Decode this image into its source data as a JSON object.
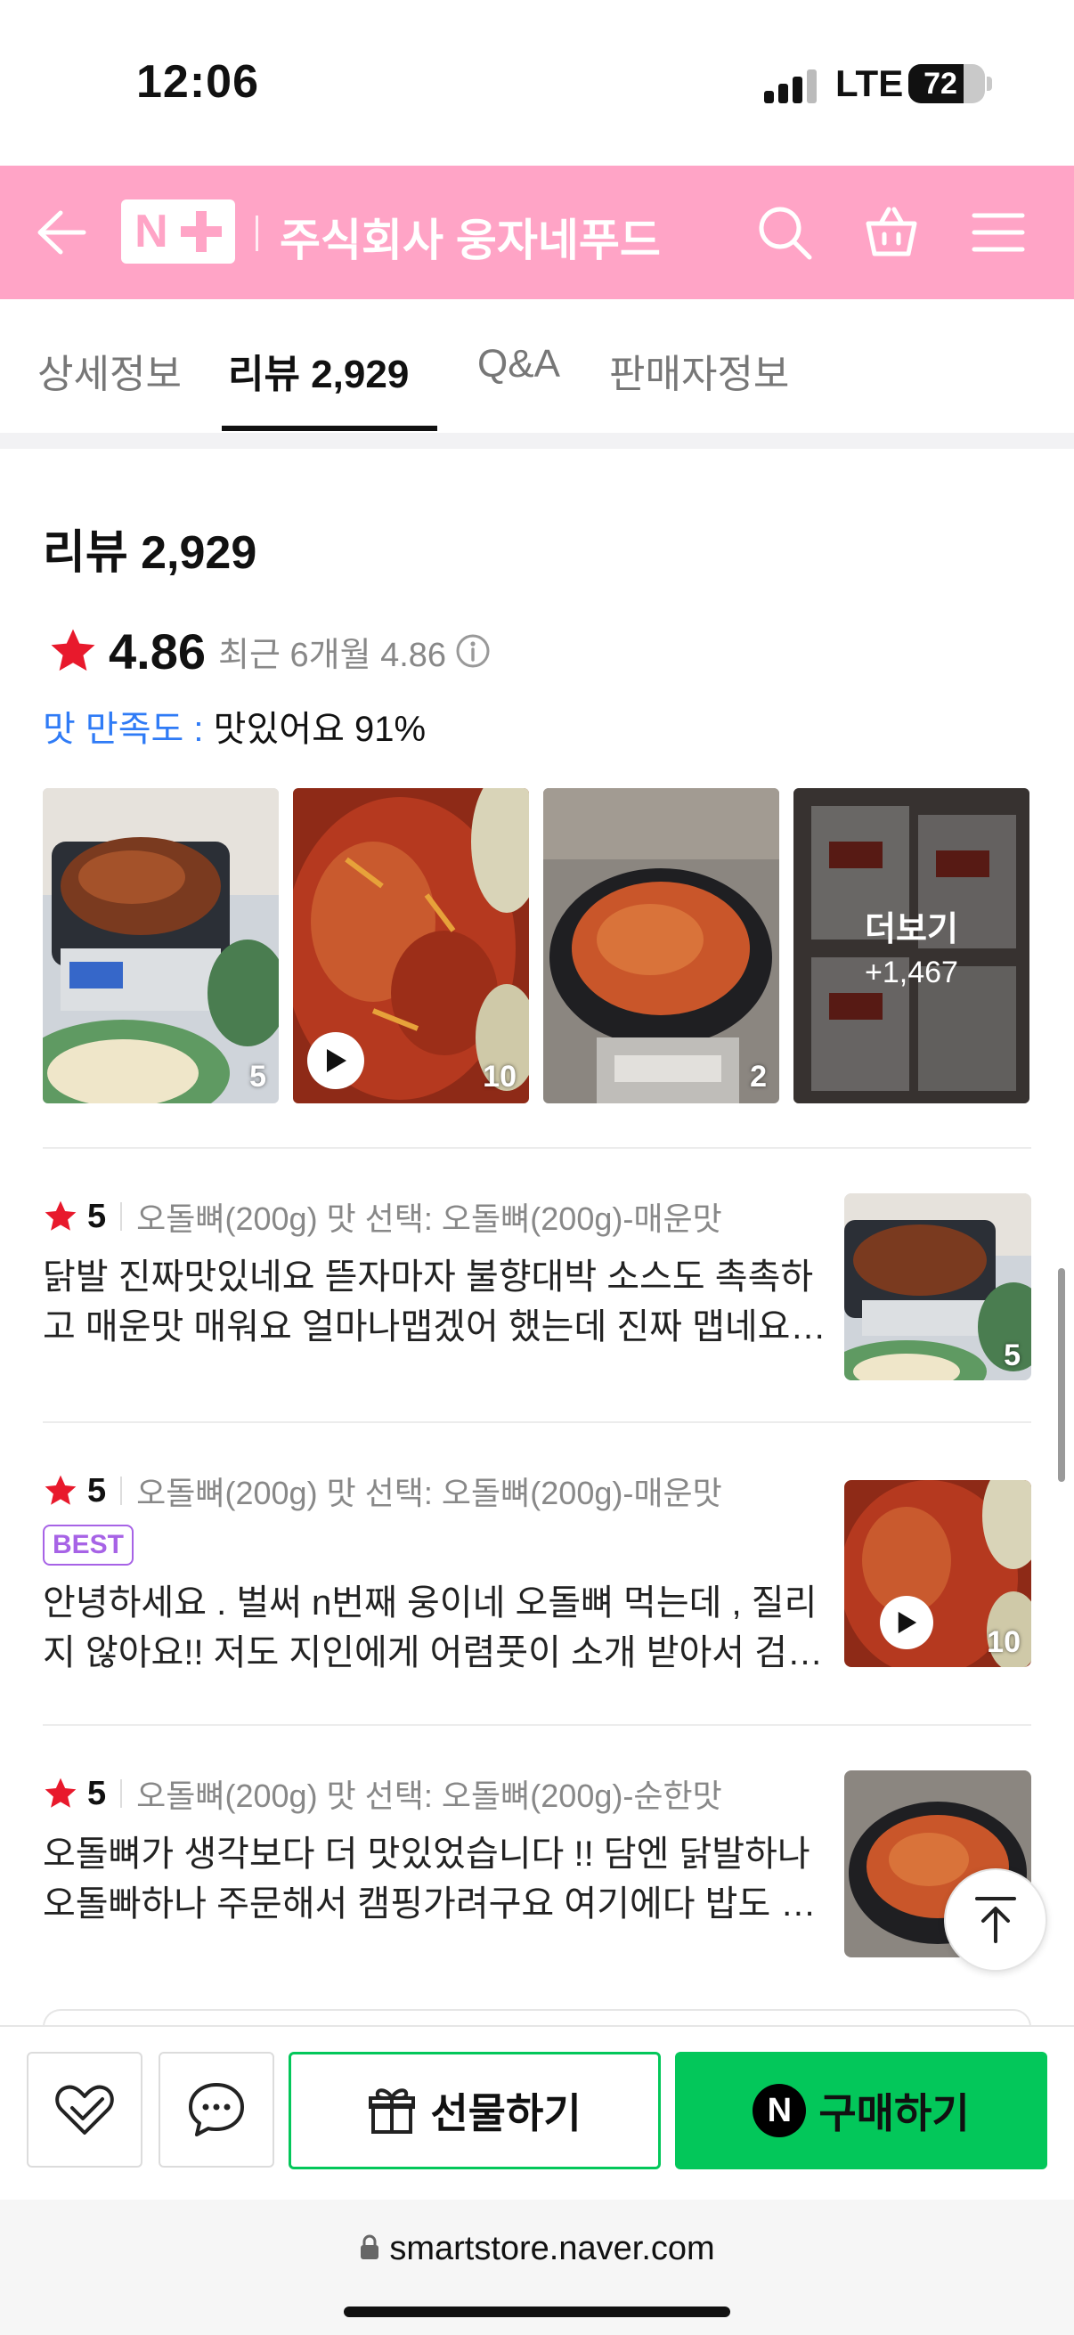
{
  "status_bar": {
    "time": "12:06",
    "network": "LTE",
    "battery": "72",
    "battery_level": 0.72
  },
  "header": {
    "logo_text": "N",
    "store_name": "주식회사 웅자네푸드"
  },
  "tabs": [
    {
      "label": "상세정보"
    },
    {
      "label": "리뷰 2,929"
    },
    {
      "label": "Q&A"
    },
    {
      "label": "판매자정보"
    }
  ],
  "reviews_summary": {
    "title": "리뷰 2,929",
    "score": "4.86",
    "recent": "최근 6개월 4.86",
    "satisfaction_label": "맛 만족도 :",
    "satisfaction_value": "맛있어요 91%"
  },
  "photos": [
    {
      "count": "5"
    },
    {
      "count": "10",
      "video": true
    },
    {
      "count": "2"
    },
    {
      "more_label": "더보기",
      "more_count": "+1,467"
    }
  ],
  "reviews": [
    {
      "score": "5",
      "option": "오돌뼈(200g) 맛 선택: 오돌뼈(200g)-매운맛",
      "line1": "닭발 진짜맛있네요 뜯자마자 불향대박 소스도 촉촉하",
      "line2": "고 매운맛 매워요 얼마나맵겠어 했는데 진짜 맵네요…",
      "thumb_count": "5"
    },
    {
      "score": "5",
      "option": "오돌뼈(200g) 맛 선택: 오돌뼈(200g)-매운맛",
      "badge": "BEST",
      "line1": "안녕하세요 . 벌써 n번째 웅이네 오돌뼈 먹는데 , 질리",
      "line2": "지 않아요!! 저도 지인에게 어렴풋이 소개 받아서 검…",
      "thumb_count": "10"
    },
    {
      "score": "5",
      "option": "오돌뼈(200g) 맛 선택: 오돌뼈(200g)-순한맛",
      "line1": "오돌뼈가 생각보다 더 맛있었습니다 !! 담엔 닭발하나",
      "line2": "오돌빠하나 주문해서 캠핑가려구요 여기에다 밥도 …"
    }
  ],
  "action_bar": {
    "gift_label": "선물하기",
    "buy_label": "구매하기",
    "buy_logo": "N"
  },
  "browser": {
    "url": "smartstore.naver.com"
  },
  "colors": {
    "brand_pink": "#ffa4c6",
    "naver_green": "#03c75a",
    "star_red": "#e8192c",
    "satisfaction_blue": "#2f7bf6",
    "best_purple": "#a763e6"
  }
}
